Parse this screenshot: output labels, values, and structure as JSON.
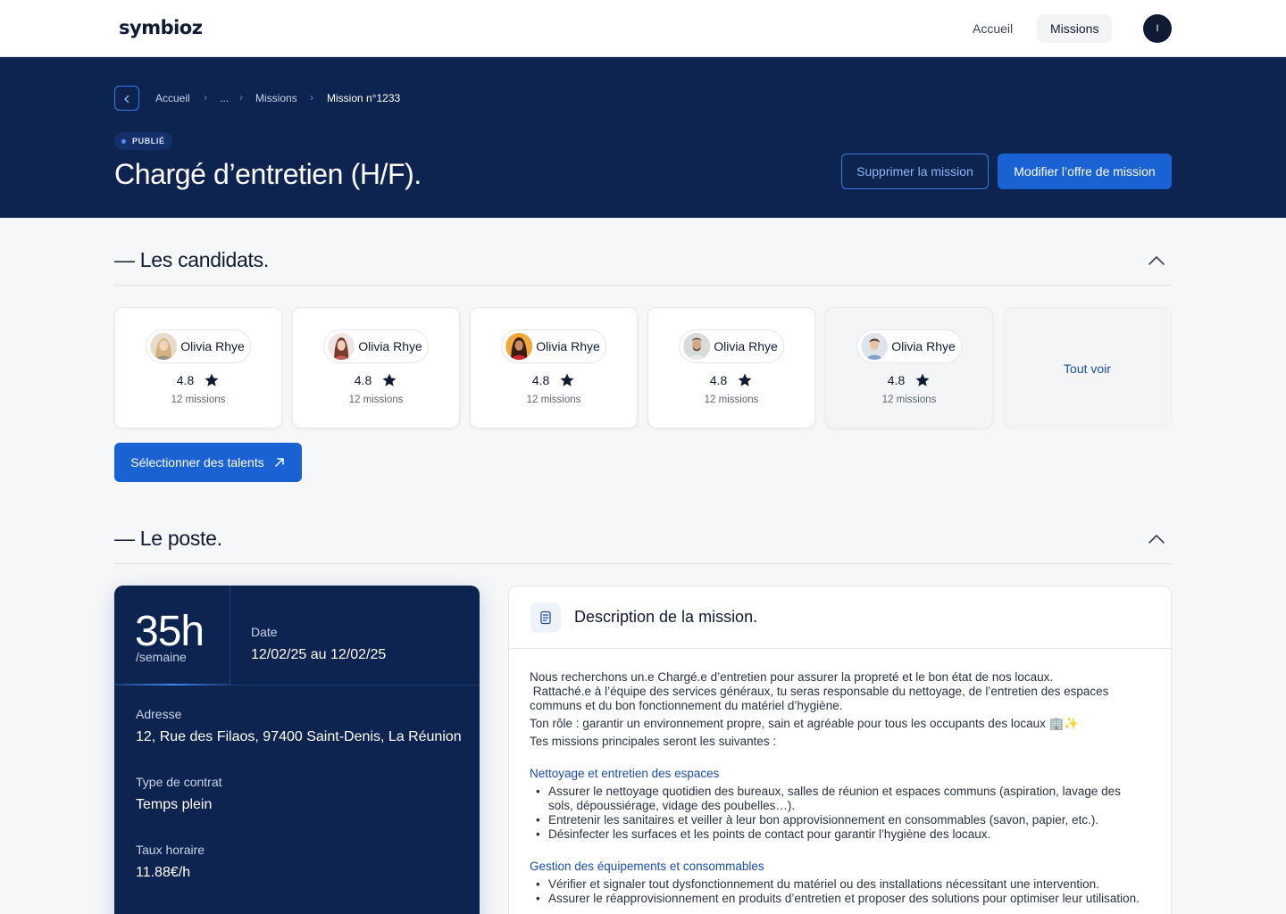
{
  "brand": {
    "logo_text": "symbioz"
  },
  "nav": {
    "items": [
      {
        "label": "Accueil"
      },
      {
        "label": "Missions"
      }
    ],
    "avatar_initial": "I"
  },
  "breadcrumb": {
    "items": [
      "Accueil",
      "...",
      "Missions",
      "Mission n°1233"
    ]
  },
  "mission": {
    "status": "PUBLIÉ",
    "title": "Chargé d’entretien (H/F).",
    "delete_label": "Supprimer la mission",
    "edit_label": "Modifier l’offre de mission"
  },
  "candidates_section": {
    "title": "— Les candidats.",
    "candidates": [
      {
        "name": "Olivia Rhye",
        "rating": "4.8",
        "missions": "12 missions"
      },
      {
        "name": "Olivia Rhye",
        "rating": "4.8",
        "missions": "12 missions"
      },
      {
        "name": "Olivia Rhye",
        "rating": "4.8",
        "missions": "12 missions"
      },
      {
        "name": "Olivia Rhye",
        "rating": "4.8",
        "missions": "12 missions"
      },
      {
        "name": "Olivia Rhye",
        "rating": "4.8",
        "missions": "12 missions"
      }
    ],
    "see_all_label": "Tout voir",
    "select_label": "Sélectionner des talents"
  },
  "post_section": {
    "title": "— Le poste.",
    "info": {
      "hours": "35h",
      "hours_unit": "/semaine",
      "date_label": "Date",
      "date_value": "12/02/25 au 12/02/25",
      "address_label": "Adresse",
      "address_value": "12, Rue des Filaos, 97400 Saint-Denis, La Réunion",
      "contract_label": "Type de contrat",
      "contract_value": "Temps plein",
      "rate_label": "Taux horaire",
      "rate_value": "11.88€/h"
    },
    "description": {
      "title": "Description de la mission.",
      "intro": [
        "Nous recherchons un.e Chargé.e d’entretien pour assurer la propreté et le bon état de nos locaux.",
        " Rattaché.e à l’équipe des services généraux, tu seras responsable du nettoyage, de l’entretien des espaces communs et du bon fonctionnement du matériel d’hygiène.",
        "Ton rôle : garantir un environnement propre, sain et agréable pour tous les occupants des locaux 🏢✨",
        "Tes missions principales seront les suivantes :"
      ],
      "sections": [
        {
          "heading": "Nettoyage et entretien des espaces",
          "bullets": [
            "Assurer le nettoyage quotidien des bureaux, salles de réunion et espaces communs (aspiration, lavage des sols, dépoussiérage, vidage des poubelles…).",
            "Entretenir les sanitaires et veiller à leur bon approvisionnement en consommables (savon, papier, etc.).",
            "Désinfecter les surfaces et les points de contact pour garantir l’hygiène des locaux."
          ]
        },
        {
          "heading": "Gestion des équipements et consommables",
          "bullets": [
            "Vérifier et signaler tout dysfonctionnement du matériel ou des installations nécessitant une intervention.",
            "Assurer le réapprovisionnement en produits d’entretien et proposer des solutions pour optimiser leur utilisation."
          ]
        }
      ]
    }
  },
  "colors": {
    "navy": "#0e2450",
    "primary": "#1a62d4",
    "link": "#1a4fa8",
    "background": "#f6f7f8"
  }
}
